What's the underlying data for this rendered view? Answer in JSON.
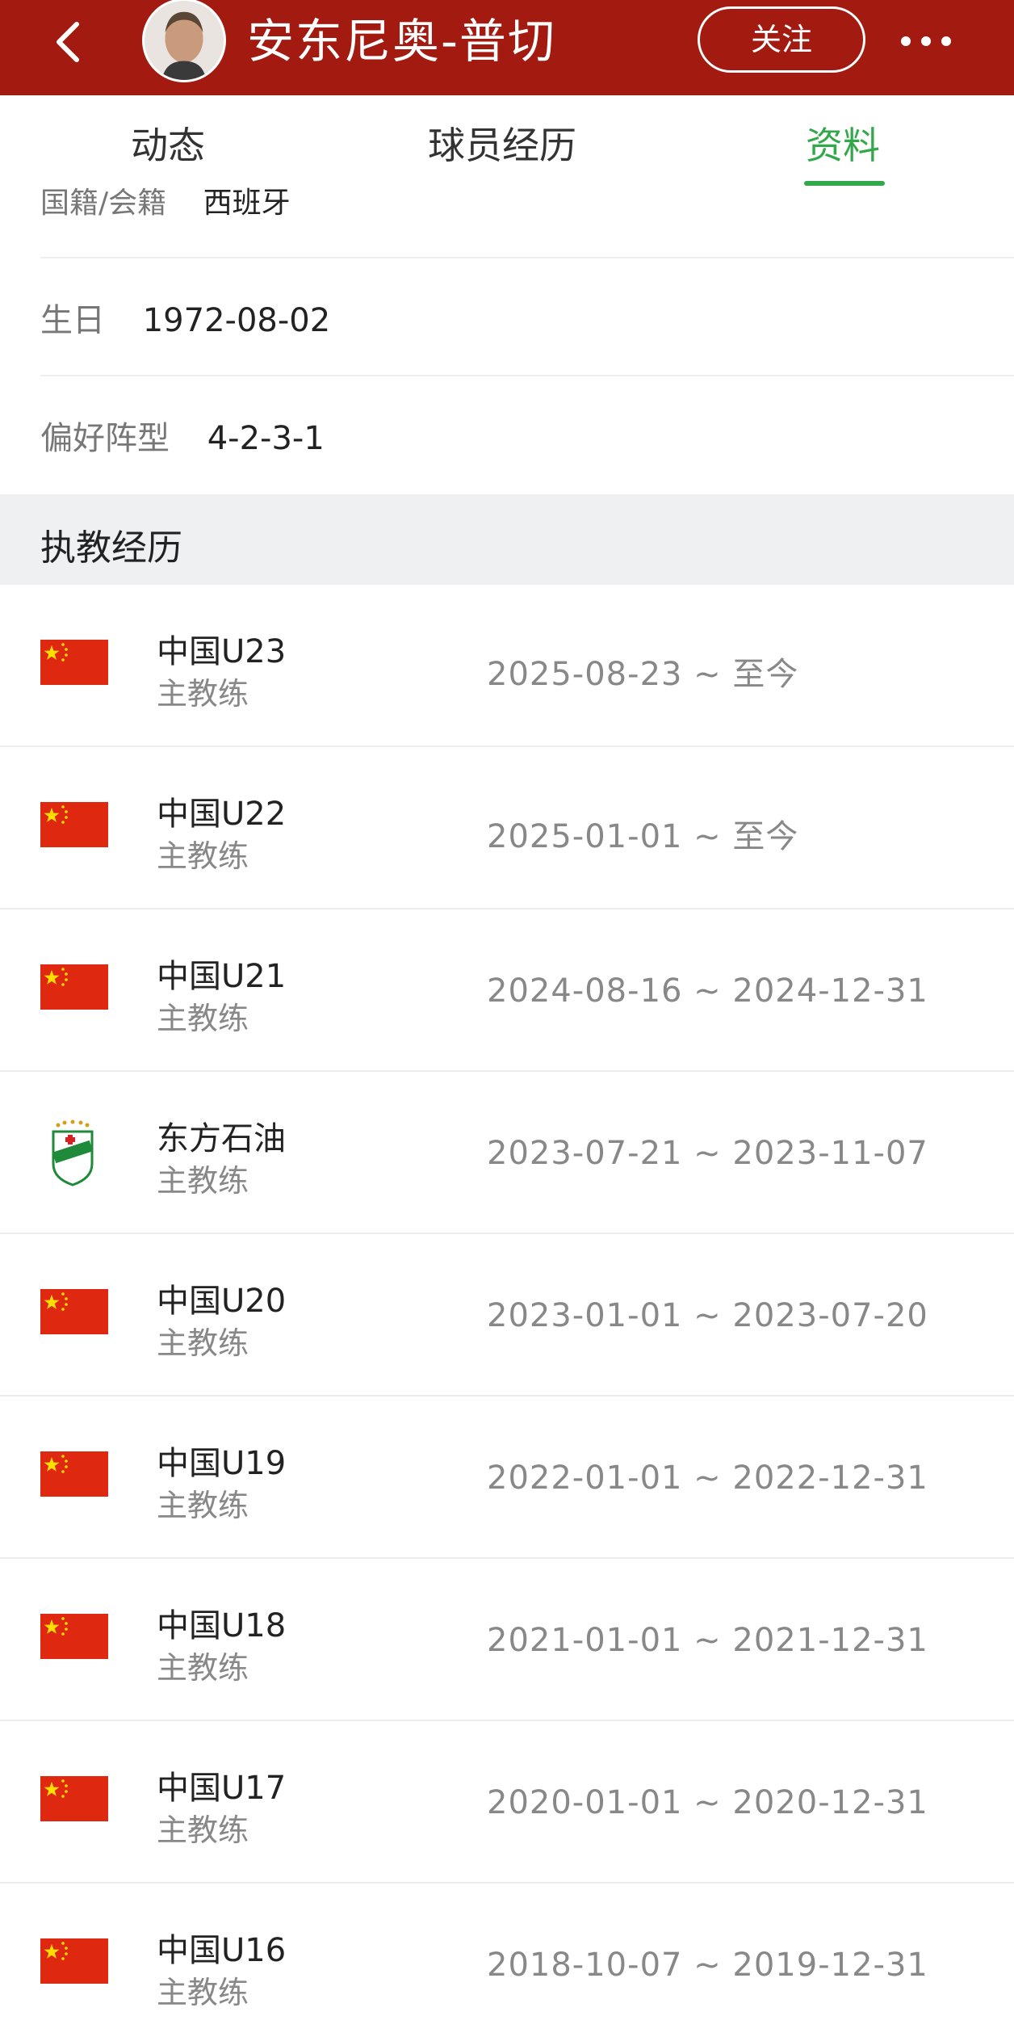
{
  "header": {
    "coach_name": "安东尼奥-普切",
    "follow_label": "关注",
    "bg_color": "#a31a10"
  },
  "tabs": [
    {
      "label": "动态",
      "active": false
    },
    {
      "label": "球员经历",
      "active": false
    },
    {
      "label": "资料",
      "active": true
    }
  ],
  "accent_color": "#32a84a",
  "profile": {
    "nationality_label": "国籍/会籍",
    "nationality_value": "西班牙",
    "birthday_label": "生日",
    "birthday_value": "1972-08-02",
    "formation_label": "偏好阵型",
    "formation_value": "4-2-3-1"
  },
  "coaching_history": {
    "title": "执教经历",
    "entries": [
      {
        "team": "中国U23",
        "role": "主教练",
        "period": "2025-08-23 ~ 至今",
        "logo": "china-flag-icon"
      },
      {
        "team": "中国U22",
        "role": "主教练",
        "period": "2025-01-01 ~ 至今",
        "logo": "china-flag-icon"
      },
      {
        "team": "中国U21",
        "role": "主教练",
        "period": "2024-08-16 ~ 2024-12-31",
        "logo": "china-flag-icon"
      },
      {
        "team": "东方石油",
        "role": "主教练",
        "period": "2023-07-21 ~ 2023-11-07",
        "logo": "club-crest-icon"
      },
      {
        "team": "中国U20",
        "role": "主教练",
        "period": "2023-01-01 ~ 2023-07-20",
        "logo": "china-flag-icon"
      },
      {
        "team": "中国U19",
        "role": "主教练",
        "period": "2022-01-01 ~ 2022-12-31",
        "logo": "china-flag-icon"
      },
      {
        "team": "中国U18",
        "role": "主教练",
        "period": "2021-01-01 ~ 2021-12-31",
        "logo": "china-flag-icon"
      },
      {
        "team": "中国U17",
        "role": "主教练",
        "period": "2020-01-01 ~ 2020-12-31",
        "logo": "china-flag-icon"
      },
      {
        "team": "中国U16",
        "role": "主教练",
        "period": "2018-10-07 ~ 2019-12-31",
        "logo": "china-flag-icon"
      }
    ]
  }
}
